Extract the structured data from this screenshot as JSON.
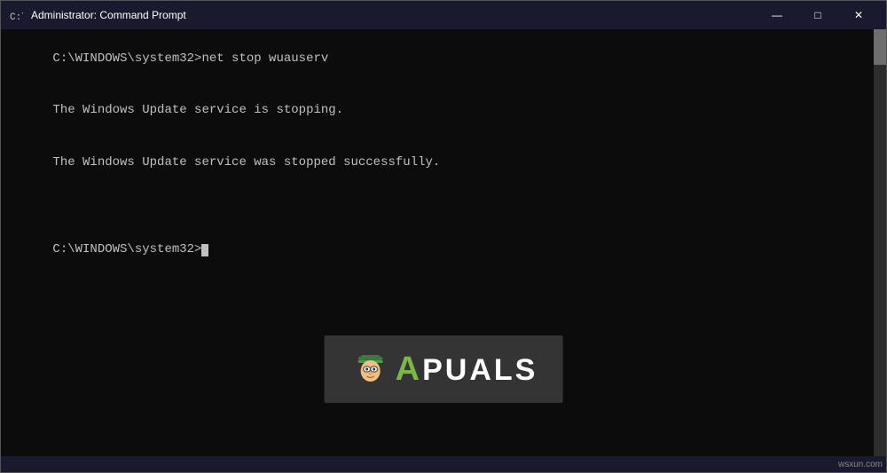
{
  "window": {
    "title": "Administrator: Command Prompt",
    "icon": "cmd-icon"
  },
  "controls": {
    "minimize": "—",
    "maximize": "□",
    "close": "✕"
  },
  "terminal": {
    "line1": "C:\\WINDOWS\\system32>net stop wuauserv",
    "line2": "The Windows Update service is stopping.",
    "line3": "The Windows Update service was stopped successfully.",
    "line4": "",
    "prompt": "C:\\WINDOWS\\system32>"
  },
  "watermark": {
    "prefix": "A",
    "suffix": "PUALS"
  },
  "bottom": {
    "site": "wsxun.com"
  }
}
